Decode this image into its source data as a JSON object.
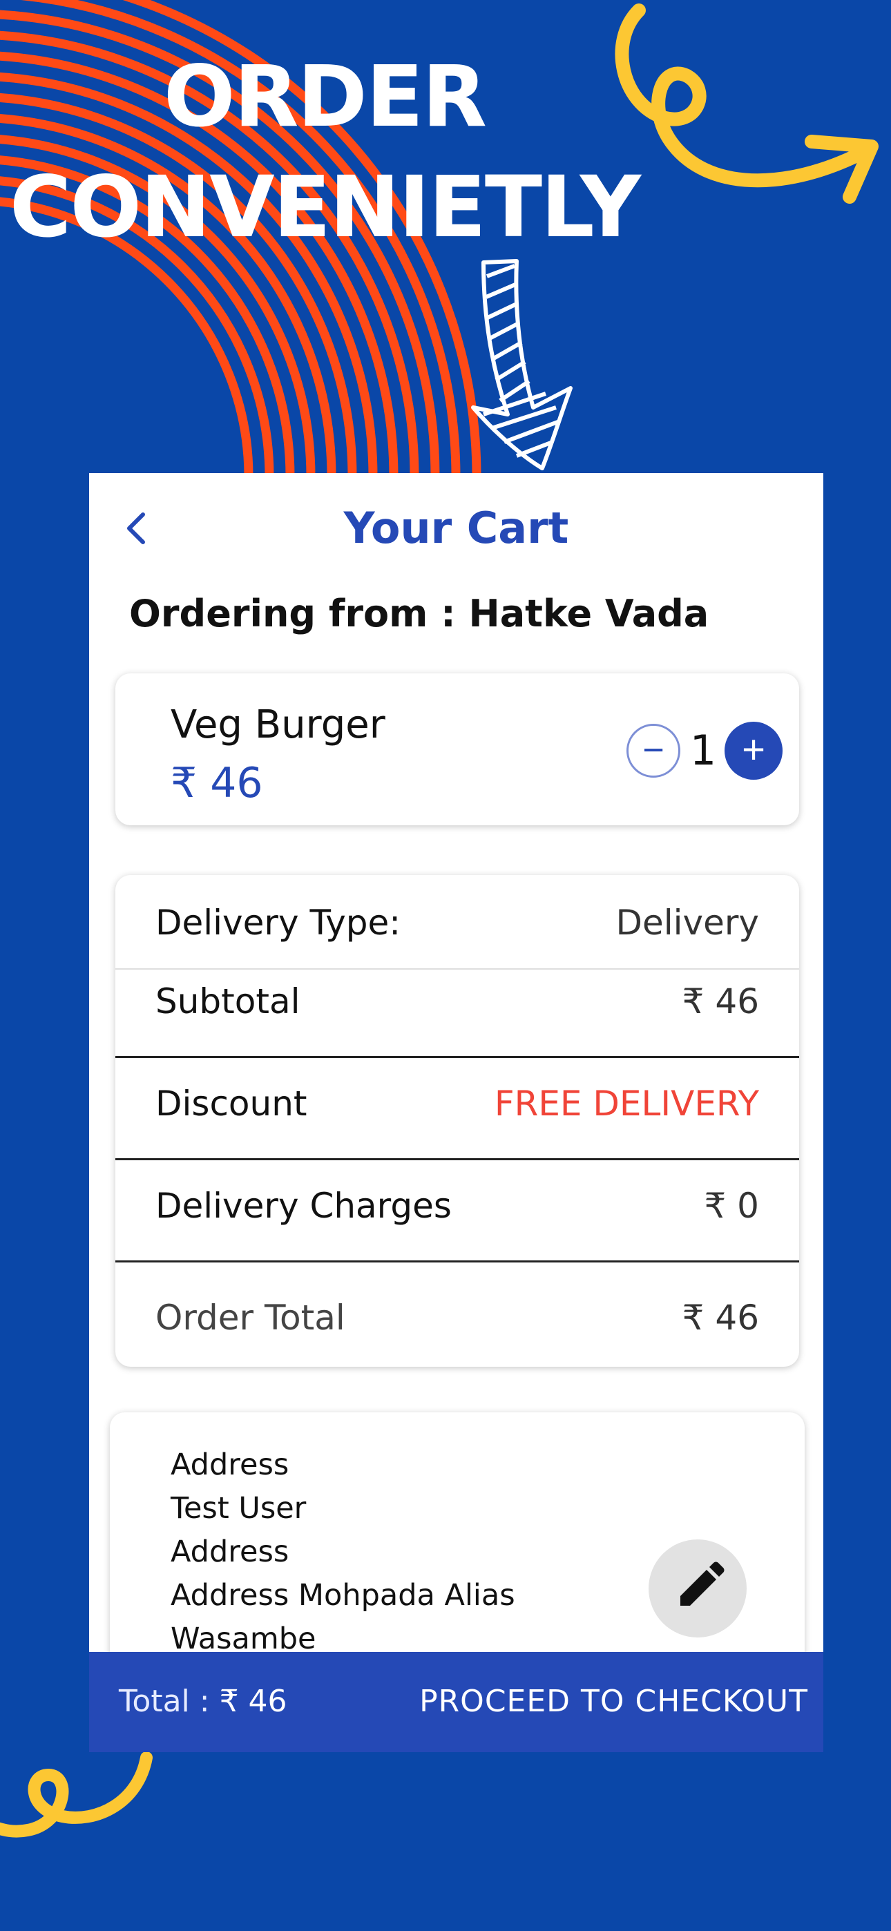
{
  "banner": {
    "line1": "ORDER",
    "line2": "CONVENIETLY"
  },
  "colors": {
    "background": "#0a47a8",
    "stripes": "#ff4a16",
    "squiggle": "#fcc733",
    "accent": "#2549b6",
    "discount": "#f04438"
  },
  "header": {
    "back_icon": "chevron-left-icon",
    "title": "Your Cart"
  },
  "ordering_from": "Ordering from : Hatke Vada",
  "cart_item": {
    "name": "Veg Burger",
    "price": "₹ 46",
    "quantity": "1",
    "minus_icon": "minus-circle-icon",
    "plus_icon": "plus-circle-icon"
  },
  "bill": {
    "delivery_type_label": "Delivery Type:",
    "delivery_type_value": "Delivery",
    "subtotal_label": "Subtotal",
    "subtotal_value": "₹ 46",
    "discount_label": "Discount",
    "discount_value": "FREE DELIVERY",
    "delivery_charges_label": "Delivery Charges",
    "delivery_charges_value": "₹ 0",
    "order_total_label": "Order Total",
    "order_total_value": "₹ 46"
  },
  "address": {
    "heading": "Address",
    "lines": [
      "Test User",
      "Address",
      "Address Mohpada Alias",
      "Wasambe"
    ],
    "edit_icon": "pencil-icon"
  },
  "checkout": {
    "total_label": "Total : ",
    "total_value": "₹ 46",
    "button": "PROCEED TO CHECKOUT"
  }
}
